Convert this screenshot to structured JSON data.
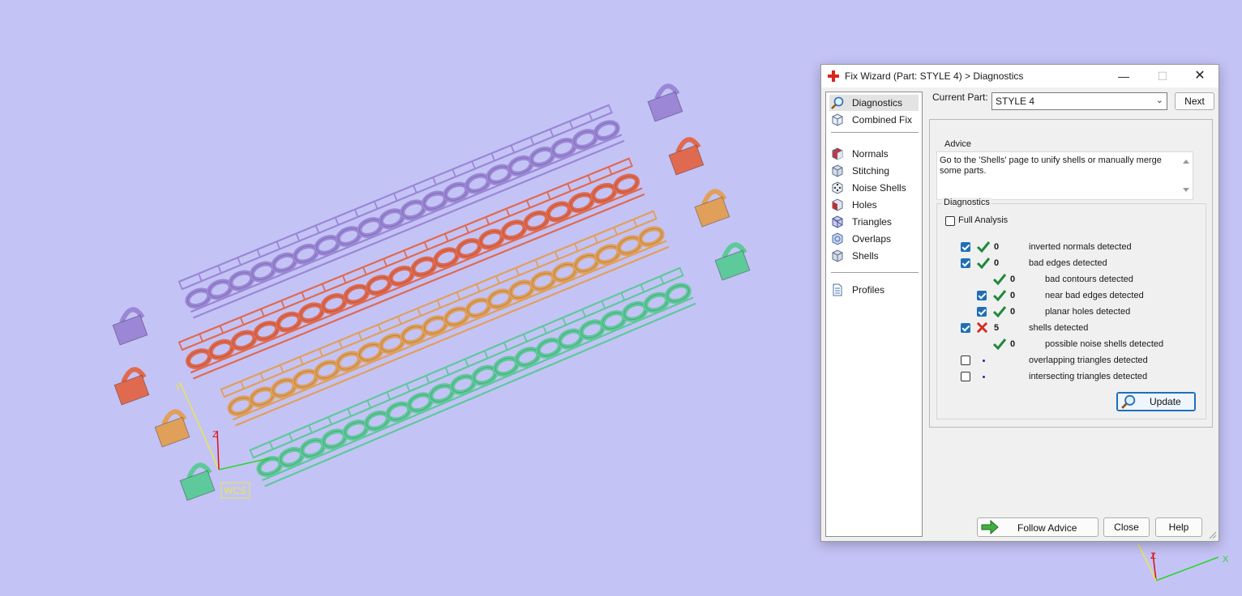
{
  "window": {
    "title": "Fix Wizard (Part: STYLE 4) > Diagnostics",
    "minimize": "—",
    "maximize": "☐",
    "close": "✕"
  },
  "nav": {
    "items": [
      {
        "label": "Diagnostics",
        "icon": "magnifier-icon",
        "selected": true
      },
      {
        "label": "Combined Fix",
        "icon": "cube-icon"
      },
      {
        "label": "Normals",
        "icon": "normals-cube-icon"
      },
      {
        "label": "Stitching",
        "icon": "stitching-cube-icon"
      },
      {
        "label": "Noise Shells",
        "icon": "noise-dice-icon"
      },
      {
        "label": "Holes",
        "icon": "holes-cube-icon"
      },
      {
        "label": "Triangles",
        "icon": "triangles-cube-icon"
      },
      {
        "label": "Overlaps",
        "icon": "overlaps-cube-icon"
      },
      {
        "label": "Shells",
        "icon": "shells-cube-icon"
      },
      {
        "label": "Profiles",
        "icon": "document-icon"
      }
    ]
  },
  "header": {
    "current_part_label": "Current Part:",
    "current_part_value": "STYLE 4",
    "next_label": "Next"
  },
  "advice": {
    "title": "Advice",
    "text": "Go to the 'Shells' page to unify shells or manually merge some parts."
  },
  "diagnostics": {
    "title": "Diagnostics",
    "full_analysis_label": "Full Analysis",
    "full_analysis_checked": false,
    "rows": [
      {
        "checked": true,
        "status": "ok",
        "count": "0",
        "label": "inverted normals detected",
        "indent": 0
      },
      {
        "checked": true,
        "status": "ok",
        "count": "0",
        "label": "bad edges detected",
        "indent": 0
      },
      {
        "checked": null,
        "status": "ok",
        "count": "0",
        "label": "bad contours detected",
        "indent": 1
      },
      {
        "checked": true,
        "status": "ok",
        "count": "0",
        "label": "near bad edges detected",
        "indent": 1
      },
      {
        "checked": true,
        "status": "ok",
        "count": "0",
        "label": "planar holes detected",
        "indent": 1
      },
      {
        "checked": true,
        "status": "error",
        "count": "5",
        "label": "shells detected",
        "indent": 0
      },
      {
        "checked": null,
        "status": "ok",
        "count": "0",
        "label": "possible noise shells detected",
        "indent": 1
      },
      {
        "checked": false,
        "status": "pending",
        "count": "",
        "label": "overlapping triangles detected",
        "indent": 0
      },
      {
        "checked": false,
        "status": "pending",
        "count": "",
        "label": "intersecting triangles detected",
        "indent": 0
      }
    ],
    "update_label": "Update"
  },
  "footer": {
    "follow_advice_label": "Follow Advice",
    "close_label": "Close",
    "help_label": "Help"
  },
  "viewport": {
    "wcs_label": "WCS",
    "axis_y_label": "Y",
    "axis_z_label": "Z",
    "axis_x_label": "X",
    "chain_colors": [
      "#9b87d6",
      "#e06a4f",
      "#e0a05a",
      "#5ec99a"
    ]
  }
}
